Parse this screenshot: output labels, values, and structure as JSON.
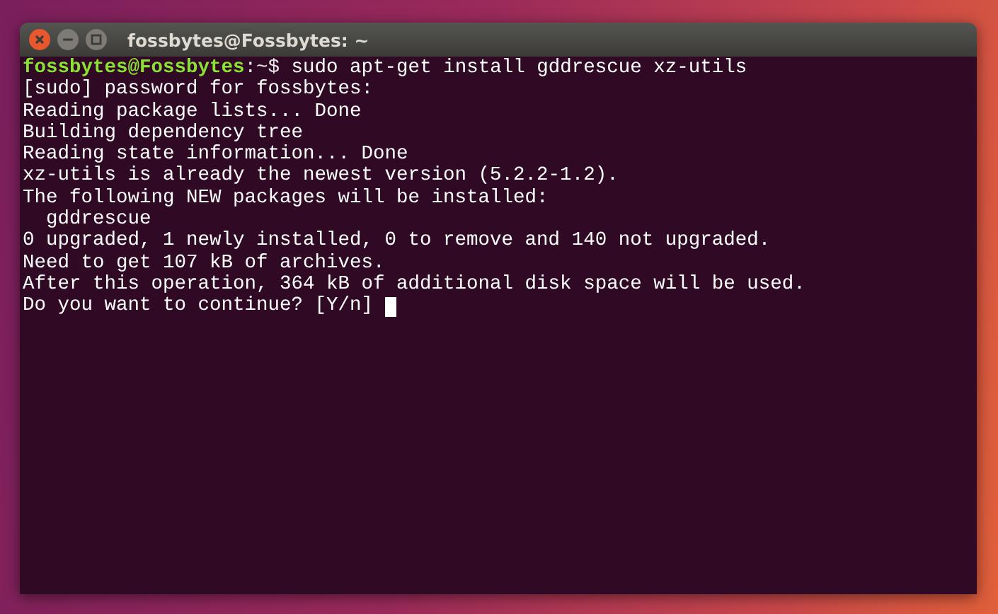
{
  "window": {
    "title": "fossbytes@Fossbytes: ~"
  },
  "terminal": {
    "lines": [
      {
        "kind": "prompt",
        "user": "fossbytes@Fossbytes",
        "path": ":~$",
        "command": "sudo apt-get install gddrescue xz-utils"
      },
      {
        "kind": "output",
        "text": "[sudo] password for fossbytes:"
      },
      {
        "kind": "output",
        "text": "Reading package lists... Done"
      },
      {
        "kind": "output",
        "text": "Building dependency tree"
      },
      {
        "kind": "output",
        "text": "Reading state information... Done"
      },
      {
        "kind": "output",
        "text": "xz-utils is already the newest version (5.2.2-1.2)."
      },
      {
        "kind": "output",
        "text": "The following NEW packages will be installed:"
      },
      {
        "kind": "output",
        "text": "  gddrescue"
      },
      {
        "kind": "output",
        "text": "0 upgraded, 1 newly installed, 0 to remove and 140 not upgraded."
      },
      {
        "kind": "output",
        "text": "Need to get 107 kB of archives."
      },
      {
        "kind": "output",
        "text": "After this operation, 364 kB of additional disk space will be used."
      },
      {
        "kind": "input",
        "text": "Do you want to continue? [Y/n] "
      }
    ]
  }
}
